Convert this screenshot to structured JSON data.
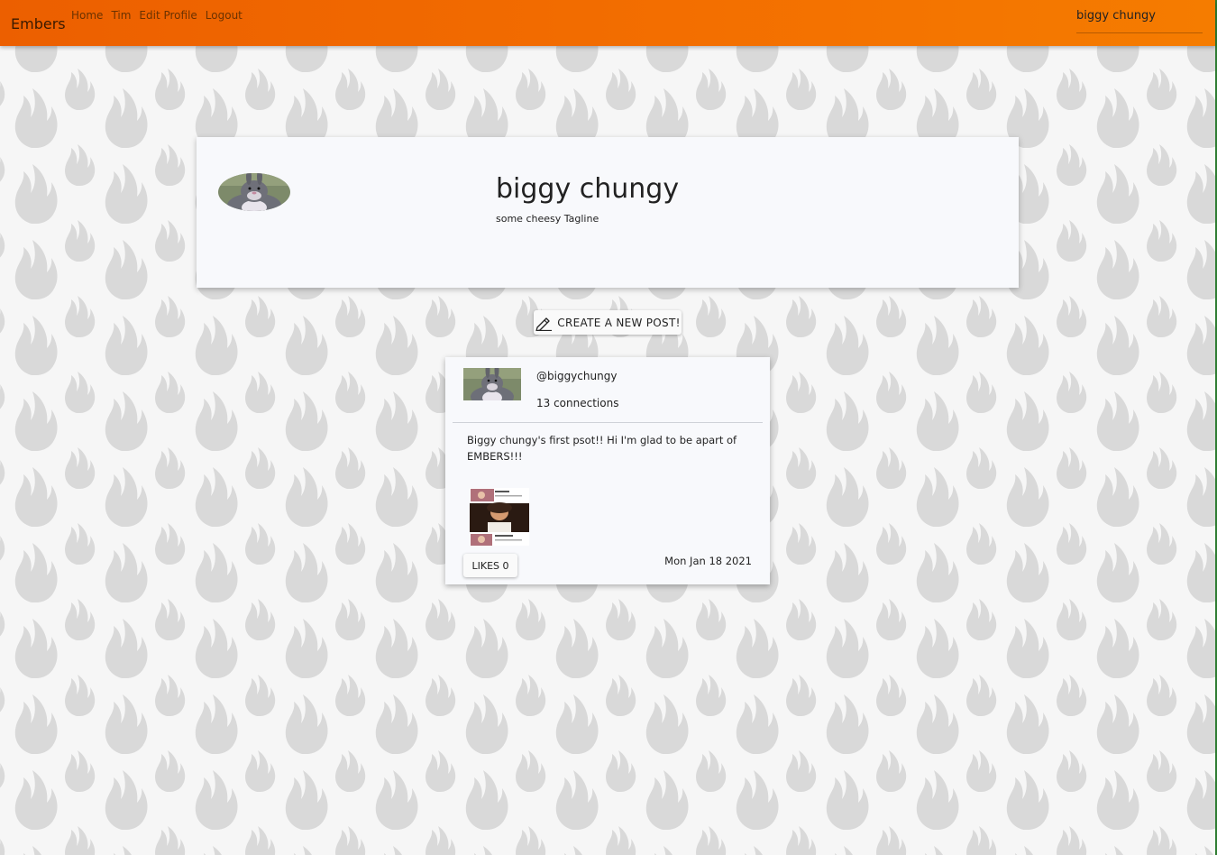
{
  "topbar": {
    "brand": "Embers",
    "nav": [
      "Home",
      "Tim",
      "Edit Profile",
      "Logout"
    ],
    "user_field_value": "biggy chungy"
  },
  "profile": {
    "name": "biggy chungy",
    "tagline": "some cheesy Tagline"
  },
  "create_post": {
    "label": "CREATE A NEW POST!"
  },
  "post": {
    "handle": "@biggychungy",
    "connections": "13 connections",
    "text": "Biggy chungy's first psot!! Hi I'm glad to be apart of EMBERS!!!",
    "likes_label": "LIKES 0",
    "date": "Mon Jan 18 2021"
  },
  "colors": {
    "topbar_start": "#ec5f00",
    "topbar_end": "#f57c00",
    "background": "#f6f6f6",
    "flame_pattern": "#d9d9d9",
    "card": "#f8f9fc"
  },
  "icons": {
    "create_post": "pencil-icon"
  }
}
